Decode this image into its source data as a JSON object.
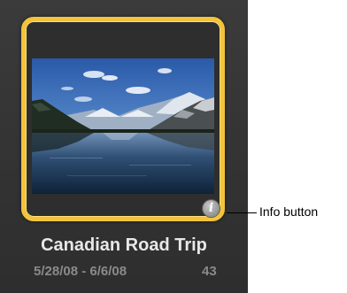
{
  "album": {
    "title": "Canadian Road Trip",
    "dates": "5/28/08 - 6/6/08",
    "count": "43",
    "info_icon": "info-icon",
    "info_glyph": "i",
    "thumbnail_subject": "mountain-lake-landscape",
    "frame_color": "#f3c33c"
  },
  "callout": {
    "label": "Info button"
  }
}
